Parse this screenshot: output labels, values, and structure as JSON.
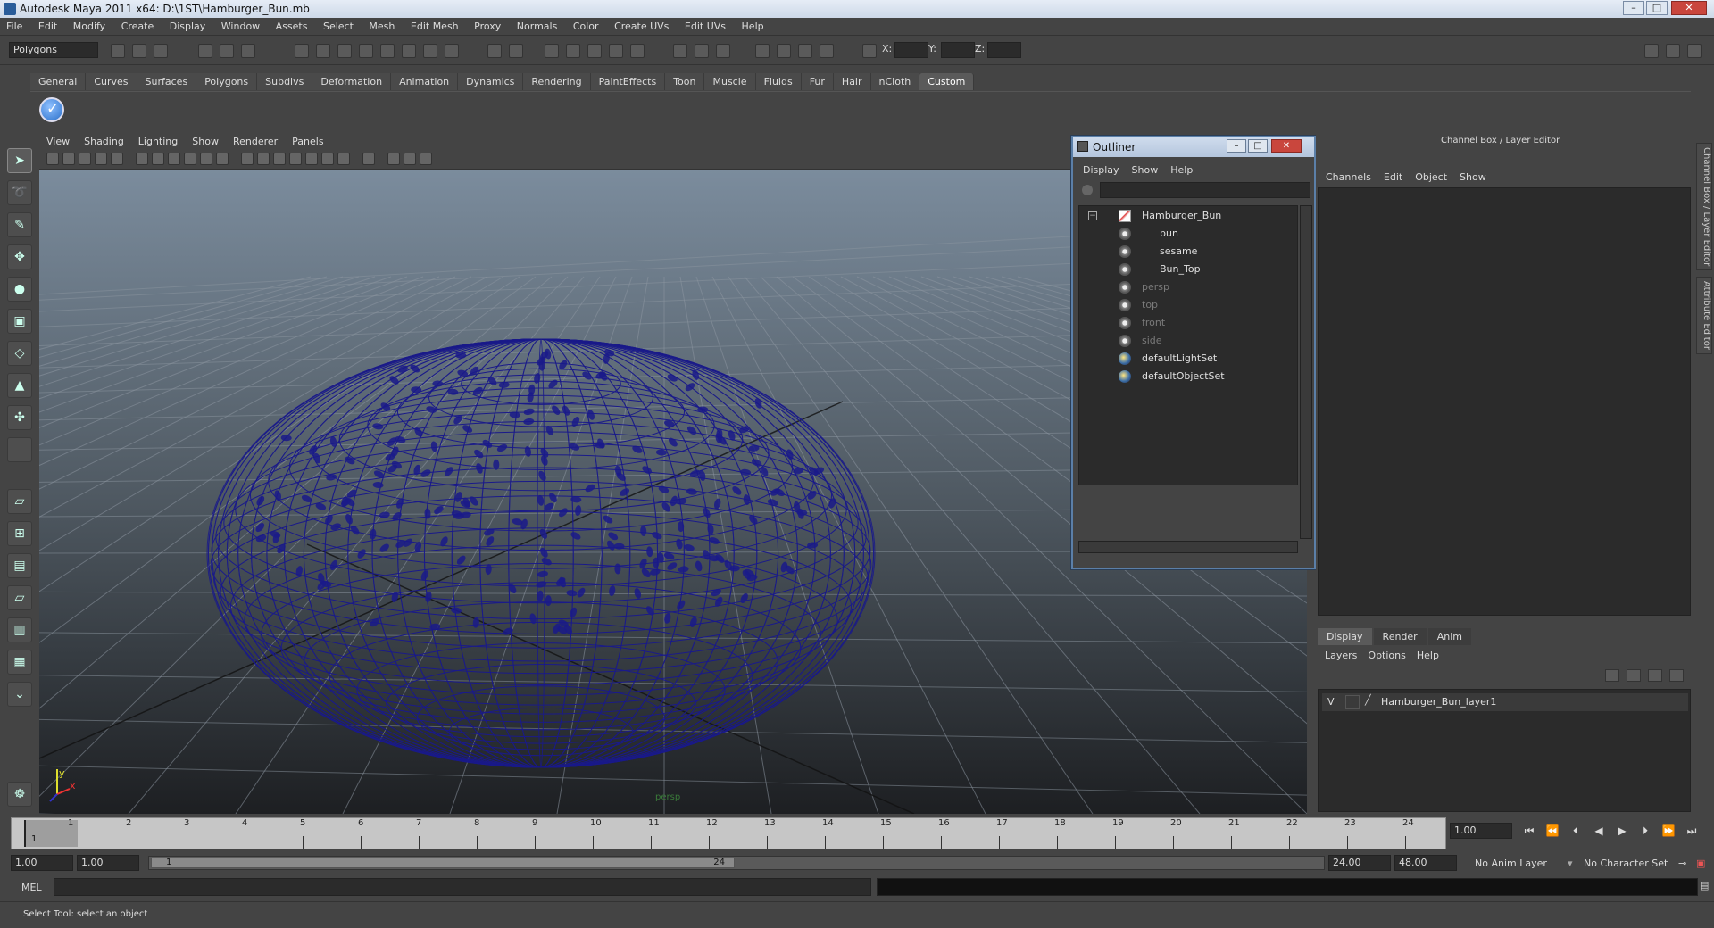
{
  "window": {
    "title": "Autodesk Maya 2011 x64: D:\\1ST\\Hamburger_Bun.mb"
  },
  "menubar": [
    "File",
    "Edit",
    "Modify",
    "Create",
    "Display",
    "Window",
    "Assets",
    "Select",
    "Mesh",
    "Edit Mesh",
    "Proxy",
    "Normals",
    "Color",
    "Create UVs",
    "Edit UVs",
    "Help"
  ],
  "statusline": {
    "mode": "Polygons",
    "x_label": "X:",
    "y_label": "Y:",
    "z_label": "Z:"
  },
  "shelf": {
    "tabs": [
      "General",
      "Curves",
      "Surfaces",
      "Polygons",
      "Subdivs",
      "Deformation",
      "Animation",
      "Dynamics",
      "Rendering",
      "PaintEffects",
      "Toon",
      "Muscle",
      "Fluids",
      "Fur",
      "Hair",
      "nCloth",
      "Custom"
    ],
    "active": "Custom"
  },
  "viewport": {
    "menu": [
      "View",
      "Shading",
      "Lighting",
      "Show",
      "Renderer",
      "Panels"
    ],
    "axis_y": "y",
    "axis_x": "x",
    "camera_label": "persp",
    "wire_color": "#1a1a8a"
  },
  "outliner": {
    "title": "Outliner",
    "menu": [
      "Display",
      "Show",
      "Help"
    ],
    "items": [
      {
        "label": "Hamburger_Bun",
        "kind": "root"
      },
      {
        "label": "bun",
        "kind": "child"
      },
      {
        "label": "sesame",
        "kind": "child"
      },
      {
        "label": "Bun_Top",
        "kind": "child"
      },
      {
        "label": "persp",
        "kind": "dim"
      },
      {
        "label": "top",
        "kind": "dim"
      },
      {
        "label": "front",
        "kind": "dim"
      },
      {
        "label": "side",
        "kind": "dim"
      },
      {
        "label": "defaultLightSet",
        "kind": "set"
      },
      {
        "label": "defaultObjectSet",
        "kind": "set"
      }
    ]
  },
  "channelbox": {
    "header": "Channel Box / Layer Editor",
    "menu": [
      "Channels",
      "Edit",
      "Object",
      "Show"
    ],
    "side_tabs": [
      "Channel Box / Layer Editor",
      "Attribute Editor"
    ]
  },
  "layereditor": {
    "tabs": [
      "Display",
      "Render",
      "Anim"
    ],
    "active": "Display",
    "menu": [
      "Layers",
      "Options",
      "Help"
    ],
    "layer": {
      "visibility": "V",
      "name": "Hamburger_Bun_layer1"
    }
  },
  "timeslider": {
    "ticks": [
      "1",
      "2",
      "3",
      "4",
      "5",
      "6",
      "7",
      "8",
      "9",
      "10",
      "11",
      "12",
      "13",
      "14",
      "15",
      "16",
      "17",
      "18",
      "19",
      "20",
      "21",
      "22",
      "23",
      "24"
    ],
    "current_marker": "1",
    "current_time": "1.00"
  },
  "range": {
    "start": "1.00",
    "playback_start": "1.00",
    "handle_start": "1",
    "handle_end": "24",
    "playback_end": "24.00",
    "end": "48.00",
    "anim_layer": "No Anim Layer",
    "char_set": "No Character Set"
  },
  "cmdline": {
    "label": "MEL"
  },
  "helpline": {
    "text": "Select Tool: select an object"
  }
}
